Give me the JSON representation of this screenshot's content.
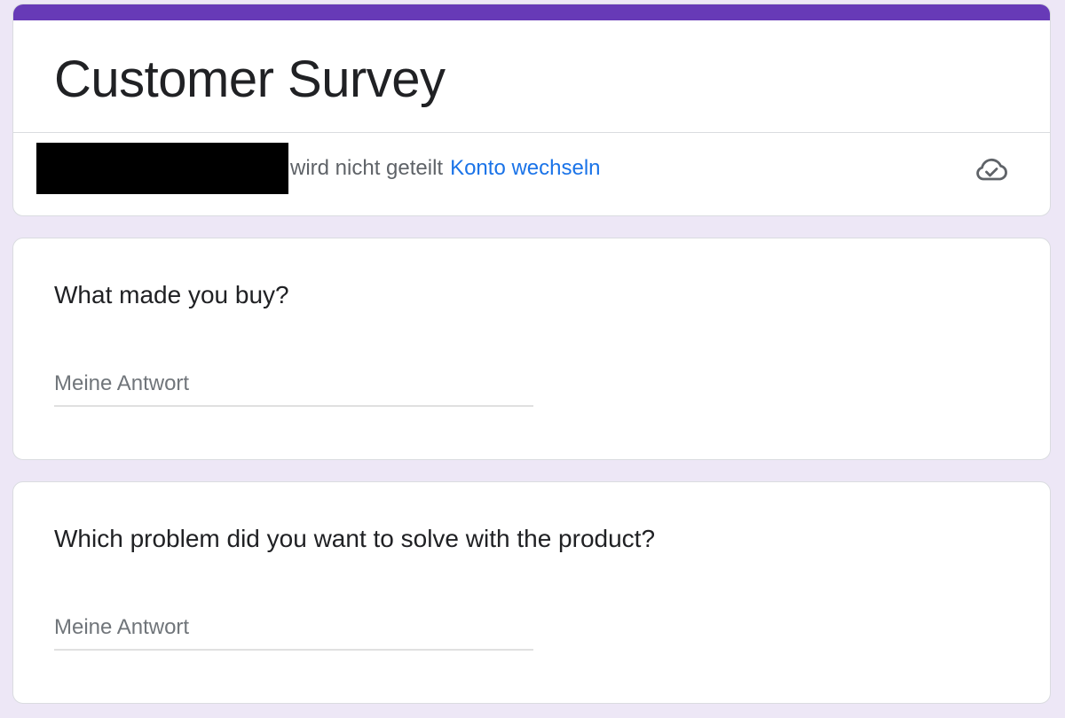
{
  "colors": {
    "page_background": "#ede7f6",
    "accent": "#673ab7",
    "link": "#1a73e8",
    "secondary_text": "#5f6368"
  },
  "form": {
    "title": "Customer Survey"
  },
  "account": {
    "email_redacted": true,
    "not_shared_text": "wird nicht geteilt",
    "switch_account_label": "Konto wechseln",
    "icon": "cloud-check-icon"
  },
  "questions": [
    {
      "title": "What made you buy?",
      "answer_placeholder": "Meine Antwort",
      "answer_value": ""
    },
    {
      "title": "Which problem did you want to solve with the product?",
      "answer_placeholder": "Meine Antwort",
      "answer_value": ""
    }
  ]
}
